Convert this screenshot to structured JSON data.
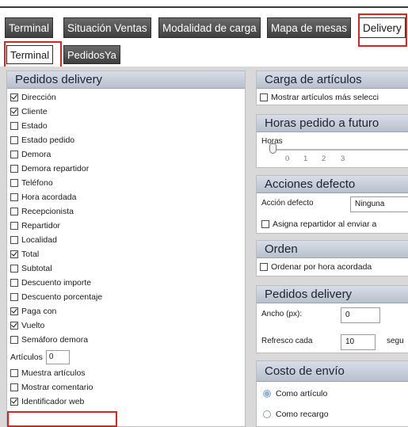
{
  "tabs": [
    {
      "label": "Terminal"
    },
    {
      "label": "Situación Ventas"
    },
    {
      "label": "Modalidad de carga"
    },
    {
      "label": "Mapa de mesas"
    },
    {
      "label": "Delivery"
    }
  ],
  "subtabs": [
    {
      "label": "Terminal"
    },
    {
      "label": "PedidosYa"
    }
  ],
  "left_panel": {
    "title": "Pedidos delivery",
    "items": [
      {
        "label": "Dirección",
        "checked": true
      },
      {
        "label": "Cliente",
        "checked": true
      },
      {
        "label": "Estado",
        "checked": false
      },
      {
        "label": "Estado pedido",
        "checked": false
      },
      {
        "label": "Demora",
        "checked": false
      },
      {
        "label": "Demora repartidor",
        "checked": false
      },
      {
        "label": "Teléfono",
        "checked": false
      },
      {
        "label": "Hora acordada",
        "checked": false
      },
      {
        "label": "Recepcionista",
        "checked": false
      },
      {
        "label": "Repartidor",
        "checked": false
      },
      {
        "label": "Localidad",
        "checked": false
      },
      {
        "label": "Total",
        "checked": true
      },
      {
        "label": "Subtotal",
        "checked": false
      },
      {
        "label": "Descuento importe",
        "checked": false
      },
      {
        "label": "Descuento porcentaje",
        "checked": false
      },
      {
        "label": "Paga con",
        "checked": true
      },
      {
        "label": "Vuelto",
        "checked": true
      },
      {
        "label": "Semáforo demora",
        "checked": false
      }
    ],
    "articulos_label": "Artículos",
    "articulos_value": "0",
    "muestra_articulos": {
      "label": "Muestra artículos",
      "checked": false
    },
    "mostrar_comentario": {
      "label": "Mostrar comentario",
      "checked": false
    },
    "identificador_web": {
      "label": "Identificador web",
      "checked": true
    }
  },
  "carga": {
    "title": "Carga de artículos",
    "option": "Mostrar artículos más selecci",
    "checked": false
  },
  "horas": {
    "title": "Horas pedido a futuro",
    "label": "Horas",
    "ticks": [
      "0",
      "1",
      "2",
      "3"
    ],
    "value": 0
  },
  "acciones": {
    "title": "Acciones defecto",
    "accion_label": "Acción defecto",
    "accion_value": "Ninguna",
    "asigna_label": "Asigna repartidor al enviar a",
    "asigna_checked": false
  },
  "orden": {
    "title": "Orden",
    "option": "Ordenar por hora acordada",
    "checked": false
  },
  "pedidos_right": {
    "title": "Pedidos delivery",
    "ancho_label": "Ancho (px):",
    "ancho_value": "0",
    "refresco_label": "Refresco cada",
    "refresco_value": "10",
    "refresco_unit": "segu"
  },
  "costo": {
    "title": "Costo de envío",
    "options": [
      {
        "label": "Como artículo",
        "selected": true
      },
      {
        "label": "Como recargo",
        "selected": false
      }
    ]
  }
}
